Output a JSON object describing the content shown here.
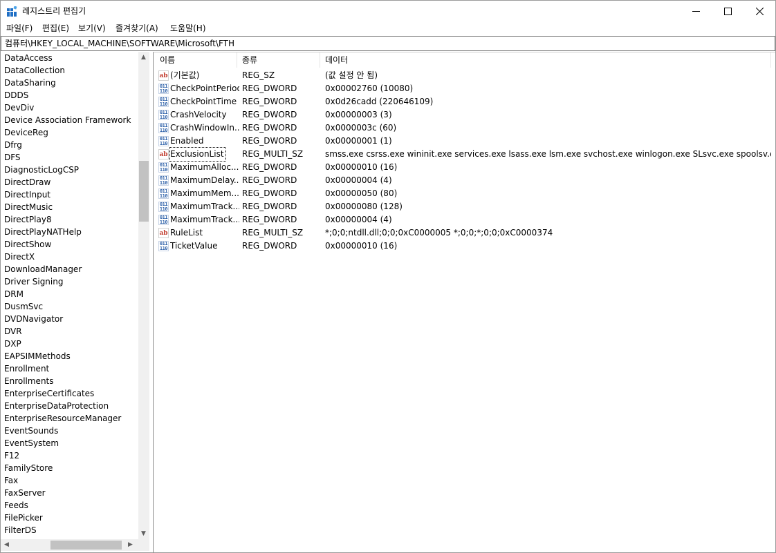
{
  "window": {
    "title": "레지스트리 편집기"
  },
  "menu": [
    "파일(F)",
    "편집(E)",
    "보기(V)",
    "즐겨찾기(A)",
    "도움말(H)"
  ],
  "address": "컴퓨터\\HKEY_LOCAL_MACHINE\\SOFTWARE\\Microsoft\\FTH",
  "tree": [
    "DataAccess",
    "DataCollection",
    "DataSharing",
    "DDDS",
    "DevDiv",
    "Device Association Framework",
    "DeviceReg",
    "Dfrg",
    "DFS",
    "DiagnosticLogCSP",
    "DirectDraw",
    "DirectInput",
    "DirectMusic",
    "DirectPlay8",
    "DirectPlayNATHelp",
    "DirectShow",
    "DirectX",
    "DownloadManager",
    "Driver Signing",
    "DRM",
    "DusmSvc",
    "DVDNavigator",
    "DVR",
    "DXP",
    "EAPSIMMethods",
    "Enrollment",
    "Enrollments",
    "EnterpriseCertificates",
    "EnterpriseDataProtection",
    "EnterpriseResourceManager",
    "EventSounds",
    "EventSystem",
    "F12",
    "FamilyStore",
    "Fax",
    "FaxServer",
    "Feeds",
    "FilePicker",
    "FilterDS"
  ],
  "columns": {
    "name": "이름",
    "type": "종류",
    "data": "데이터"
  },
  "values": [
    {
      "name": "(기본값)",
      "type": "REG_SZ",
      "data": "(값 설정 안 됨)",
      "icon": "string-value-icon"
    },
    {
      "name": "CheckPointPeriod",
      "type": "REG_DWORD",
      "data": "0x00002760 (10080)",
      "icon": "binary-value-icon"
    },
    {
      "name": "CheckPointTime",
      "type": "REG_DWORD",
      "data": "0x0d26cadd (220646109)",
      "icon": "binary-value-icon"
    },
    {
      "name": "CrashVelocity",
      "type": "REG_DWORD",
      "data": "0x00000003 (3)",
      "icon": "binary-value-icon"
    },
    {
      "name": "CrashWindowIn...",
      "type": "REG_DWORD",
      "data": "0x0000003c (60)",
      "icon": "binary-value-icon"
    },
    {
      "name": "Enabled",
      "type": "REG_DWORD",
      "data": "0x00000001 (1)",
      "icon": "binary-value-icon"
    },
    {
      "name": "ExclusionList",
      "type": "REG_MULTI_SZ",
      "data": "smss.exe csrss.exe wininit.exe services.exe lsass.exe lsm.exe svchost.exe winlogon.exe SLsvc.exe spoolsv.exe taskhost....",
      "icon": "string-value-icon"
    },
    {
      "name": "MaximumAlloc...",
      "type": "REG_DWORD",
      "data": "0x00000010 (16)",
      "icon": "binary-value-icon"
    },
    {
      "name": "MaximumDelay...",
      "type": "REG_DWORD",
      "data": "0x00000004 (4)",
      "icon": "binary-value-icon"
    },
    {
      "name": "MaximumMem...",
      "type": "REG_DWORD",
      "data": "0x00000050 (80)",
      "icon": "binary-value-icon"
    },
    {
      "name": "MaximumTrack...",
      "type": "REG_DWORD",
      "data": "0x00000080 (128)",
      "icon": "binary-value-icon"
    },
    {
      "name": "MaximumTrack...",
      "type": "REG_DWORD",
      "data": "0x00000004 (4)",
      "icon": "binary-value-icon"
    },
    {
      "name": "RuleList",
      "type": "REG_MULTI_SZ",
      "data": "*;0;0;ntdll.dll;0;0;0xC0000005 *;0;0;*;0;0;0xC0000374",
      "icon": "string-value-icon"
    },
    {
      "name": "TicketValue",
      "type": "REG_DWORD",
      "data": "0x00000010 (16)",
      "icon": "binary-value-icon"
    }
  ]
}
